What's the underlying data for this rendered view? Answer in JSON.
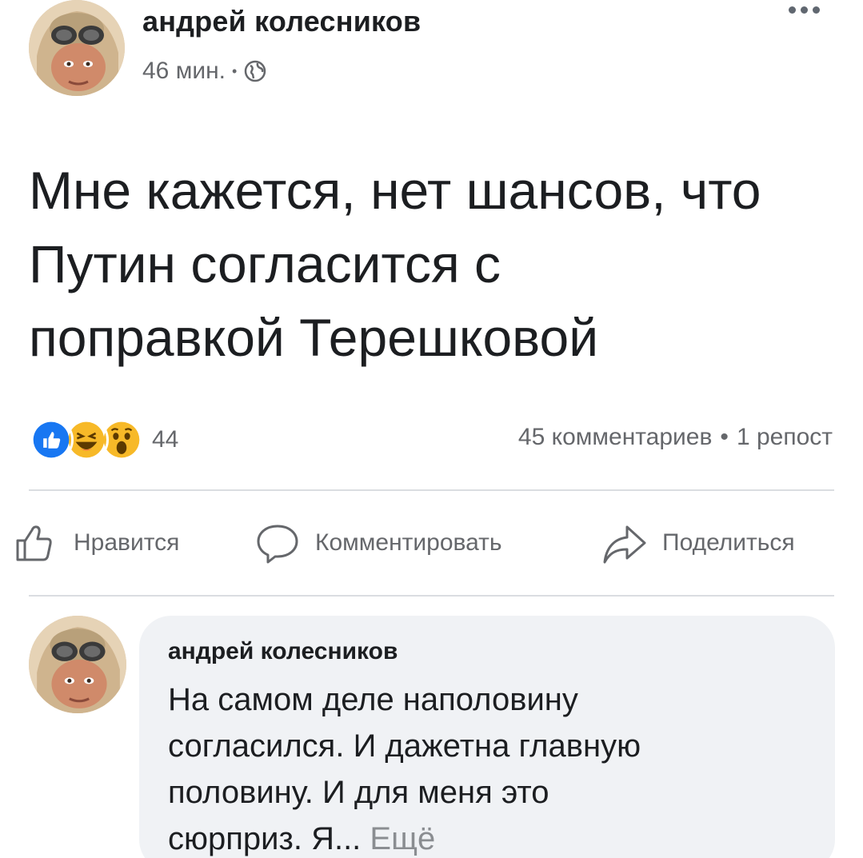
{
  "post": {
    "author": "андрей колесников",
    "time": "46 мин.",
    "separator": "•",
    "privacy_icon": "globe-icon",
    "more_icon": "more-dots-icon",
    "text_lines": [
      "Мне кажется, нет шансов, что",
      "Путин согласится с",
      "поправкой Терешковой"
    ]
  },
  "stats": {
    "reaction_icons": [
      "like-reaction-icon",
      "haha-reaction-icon",
      "wow-reaction-icon"
    ],
    "reaction_count": "44",
    "comments": "45 комментариев",
    "separator": "•",
    "shares": "1 репост"
  },
  "actions": {
    "like": "Нравится",
    "comment": "Комментировать",
    "share": "Поделиться"
  },
  "comment": {
    "author": "андрей колесников",
    "text_lines": [
      "На самом деле наполовину",
      "согласился. И дажетна главную",
      "половину. И для меня это"
    ],
    "last_line": "сюрприз. Я...",
    "see_more": "Ещё"
  },
  "colors": {
    "secondary_text": "#65676b",
    "like_blue": "#1877f2",
    "reaction_yellow": "#f7b928",
    "bubble_bg": "#f0f2f5"
  }
}
